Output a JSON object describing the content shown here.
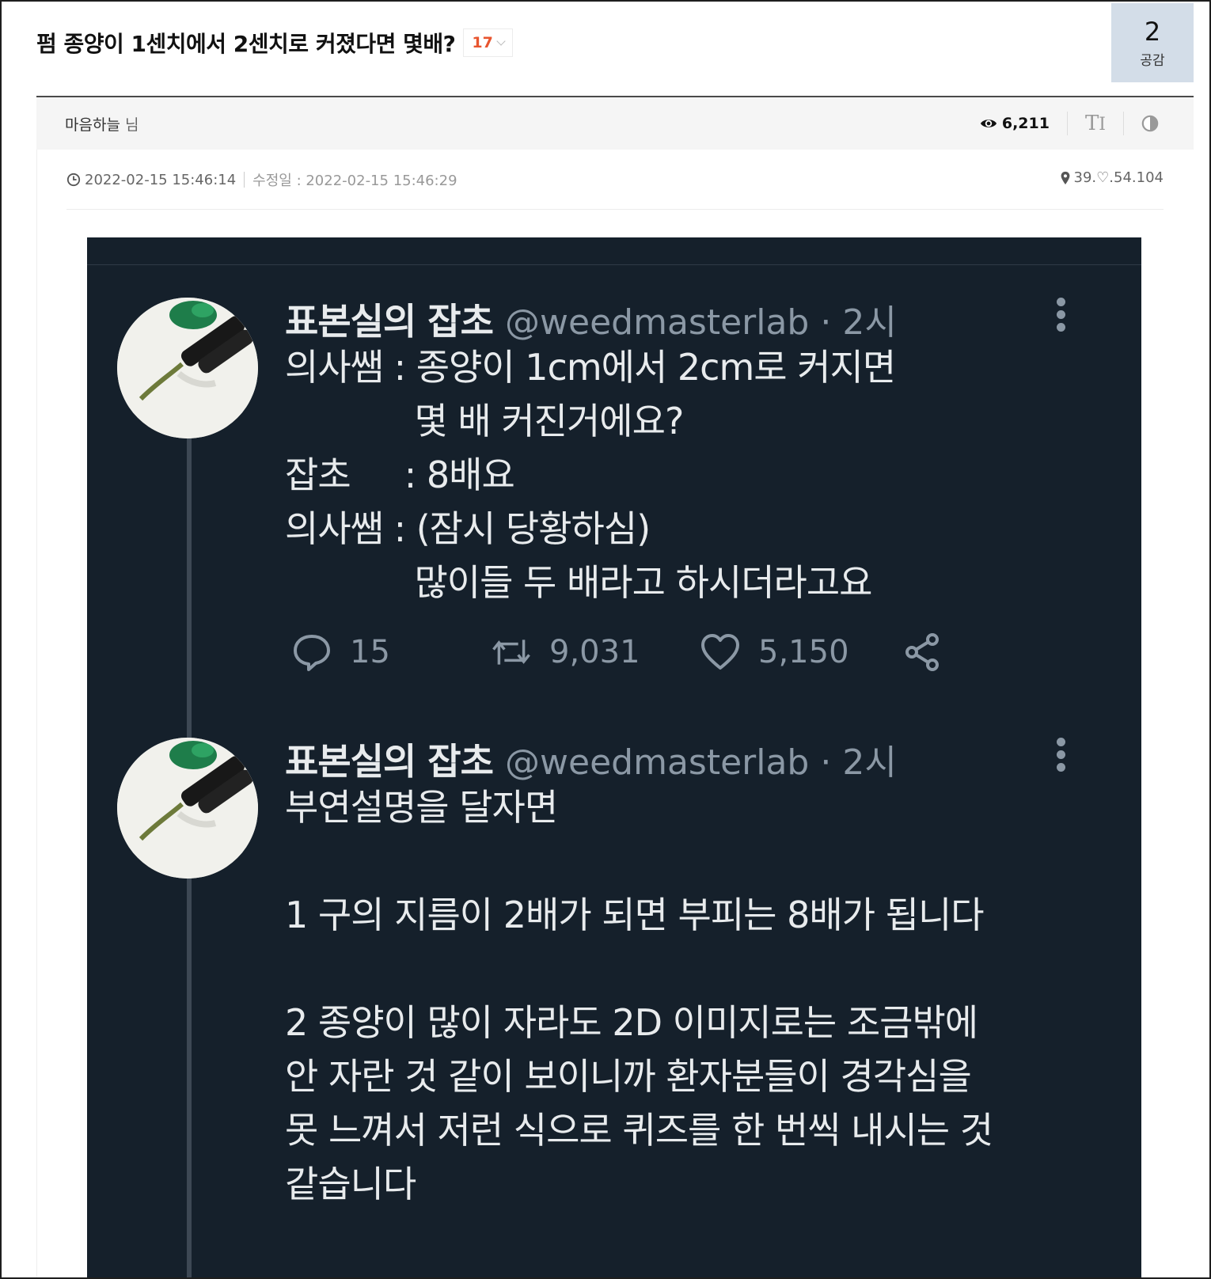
{
  "post": {
    "title": "펌 종양이 1센치에서 2센치로 커졌다면 몇배?",
    "comment_count": "17",
    "like_count": "2",
    "like_label": "공감",
    "author": "마음하늘",
    "author_suffix": "님",
    "views": "6,211",
    "posted": "2022-02-15 15:46:14",
    "edited": "수정일 : 2022-02-15 15:46:29",
    "ip": "39.♡.54.104"
  },
  "icons": [
    "chevron-down-icon",
    "eye-icon",
    "font-size-icon",
    "contrast-icon",
    "clock-icon",
    "pin-icon",
    "more-icon",
    "reply-icon",
    "retweet-icon",
    "heart-icon",
    "share-icon"
  ],
  "colors": {
    "comment_count": "#e8552f",
    "like_box": "#d3dde8",
    "tweet_bg": "#15202b",
    "tweet_text": "#e8ebed",
    "tweet_muted": "#8b98a5"
  },
  "tweets": [
    {
      "name": "표본실의 잡초",
      "handle": "@weedmasterlab · 2시",
      "text": "의사쌤 : 종양이 1cm에서 2cm로 커지면\n            몇 배 커진거에요?\n잡초     : 8배요\n의사쌤 : (잠시 당황하심)\n            많이들 두 배라고 하시더라고요",
      "replies": "15",
      "retweets": "9,031",
      "likes": "5,150"
    },
    {
      "name": "표본실의 잡초",
      "handle": "@weedmasterlab · 2시",
      "text": "부연설명을 달자면\n\n1 구의 지름이 2배가 되면 부피는 8배가 됩니다\n\n2 종양이 많이 자라도 2D 이미지로는 조금밖에\n안 자란 것 같이 보이니까 환자분들이 경각심을\n못 느껴서 저런 식으로 퀴즈를 한 번씩 내시는 것\n같습니다"
    }
  ]
}
